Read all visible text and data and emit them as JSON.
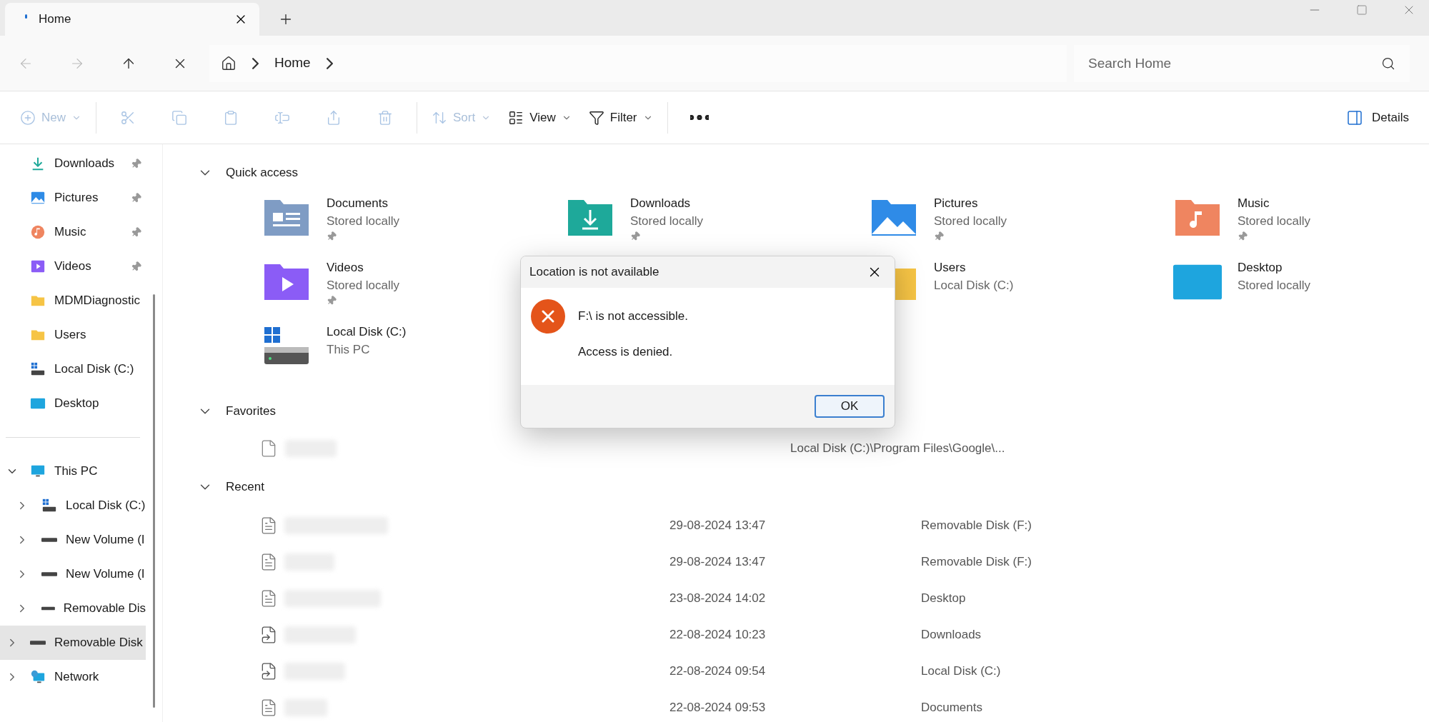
{
  "tabs": [
    {
      "label": "Home",
      "selected": true
    }
  ],
  "address": {
    "crumbs": [
      "Home"
    ],
    "search_placeholder": "Search Home"
  },
  "toolbar": {
    "items": [
      {
        "kind": "new",
        "label": "New",
        "disabled": true
      },
      {
        "kind": "cut",
        "disabled": true
      },
      {
        "kind": "copy",
        "disabled": true
      },
      {
        "kind": "paste",
        "disabled": true
      },
      {
        "kind": "rename",
        "disabled": true
      },
      {
        "kind": "share",
        "disabled": true
      },
      {
        "kind": "delete",
        "disabled": true
      },
      {
        "kind": "sort",
        "label": "Sort",
        "disabled": true
      },
      {
        "kind": "view",
        "label": "View",
        "disabled": false
      },
      {
        "kind": "filter",
        "label": "Filter",
        "disabled": false
      },
      {
        "kind": "more",
        "disabled": false
      }
    ],
    "details": "Details"
  },
  "sidebar": {
    "pinned": [
      {
        "label": "Downloads",
        "kind": "downloads",
        "pinned": true
      },
      {
        "label": "Pictures",
        "kind": "pictures",
        "pinned": true
      },
      {
        "label": "Music",
        "kind": "music",
        "pinned": true
      },
      {
        "label": "Videos",
        "kind": "videos",
        "pinned": true
      },
      {
        "label": "MDMDiagnostic",
        "kind": "folder",
        "pinned": false
      },
      {
        "label": "Users",
        "kind": "folder",
        "pinned": false
      },
      {
        "label": "Local Disk (C:)",
        "kind": "disk",
        "pinned": false
      },
      {
        "label": "Desktop",
        "kind": "desktop",
        "pinned": false
      }
    ],
    "tree": [
      {
        "label": "This PC",
        "kind": "pc",
        "expanded": true,
        "selected": false,
        "children": [
          {
            "label": "Local Disk (C:)",
            "kind": "disk",
            "expanded": false,
            "selected": false
          },
          {
            "label": "New Volume (I",
            "kind": "drive",
            "expanded": false,
            "selected": false
          },
          {
            "label": "New Volume (I",
            "kind": "drive",
            "expanded": false,
            "selected": false
          },
          {
            "label": "Removable Dis",
            "kind": "drive",
            "expanded": false,
            "selected": false
          }
        ]
      },
      {
        "label": "Removable Disk",
        "kind": "drive",
        "expanded": false,
        "selected": true
      },
      {
        "label": "Network",
        "kind": "network",
        "expanded": false,
        "selected": false
      }
    ]
  },
  "quick_access": {
    "title": "Quick access",
    "expanded": true,
    "items": [
      {
        "name": "Documents",
        "sub": "Stored locally",
        "kind": "documents",
        "pinned": true
      },
      {
        "name": "Downloads",
        "sub": "Stored locally",
        "kind": "downloads",
        "pinned": true
      },
      {
        "name": "Pictures",
        "sub": "Stored locally",
        "kind": "pictures",
        "pinned": true
      },
      {
        "name": "Music",
        "sub": "Stored locally",
        "kind": "music",
        "pinned": true
      },
      {
        "name": "Videos",
        "sub": "Stored locally",
        "kind": "videos",
        "pinned": true
      },
      {
        "kind": "hidden"
      },
      {
        "name": "Users",
        "sub": "Local Disk (C:)",
        "kind": "folder",
        "pinned": false
      },
      {
        "name": "Desktop",
        "sub": "Stored locally",
        "kind": "desktop",
        "pinned": false
      },
      {
        "name": "Local Disk (C:)",
        "sub": "This PC",
        "kind": "disk",
        "pinned": false
      }
    ]
  },
  "favorites": {
    "title": "Favorites",
    "expanded": true,
    "rows": [
      {
        "kind": "file",
        "location": "Local Disk (C:)\\Program Files\\Google\\..."
      }
    ]
  },
  "recent": {
    "title": "Recent",
    "expanded": true,
    "rows": [
      {
        "kind": "text",
        "date": "29-08-2024 13:47",
        "location": "Removable Disk (F:)"
      },
      {
        "kind": "text",
        "date": "29-08-2024 13:47",
        "location": "Removable Disk (F:)"
      },
      {
        "kind": "text",
        "date": "23-08-2024 14:02",
        "location": "Desktop"
      },
      {
        "kind": "link",
        "date": "22-08-2024 10:23",
        "location": "Downloads"
      },
      {
        "kind": "link",
        "date": "22-08-2024 09:54",
        "location": "Local Disk (C:)"
      },
      {
        "kind": "text",
        "date": "22-08-2024 09:53",
        "location": "Documents"
      }
    ]
  },
  "dialog": {
    "title": "Location is not available",
    "lines": [
      "F:\\ is not accessible.",
      "Access is denied."
    ],
    "button": "OK"
  }
}
